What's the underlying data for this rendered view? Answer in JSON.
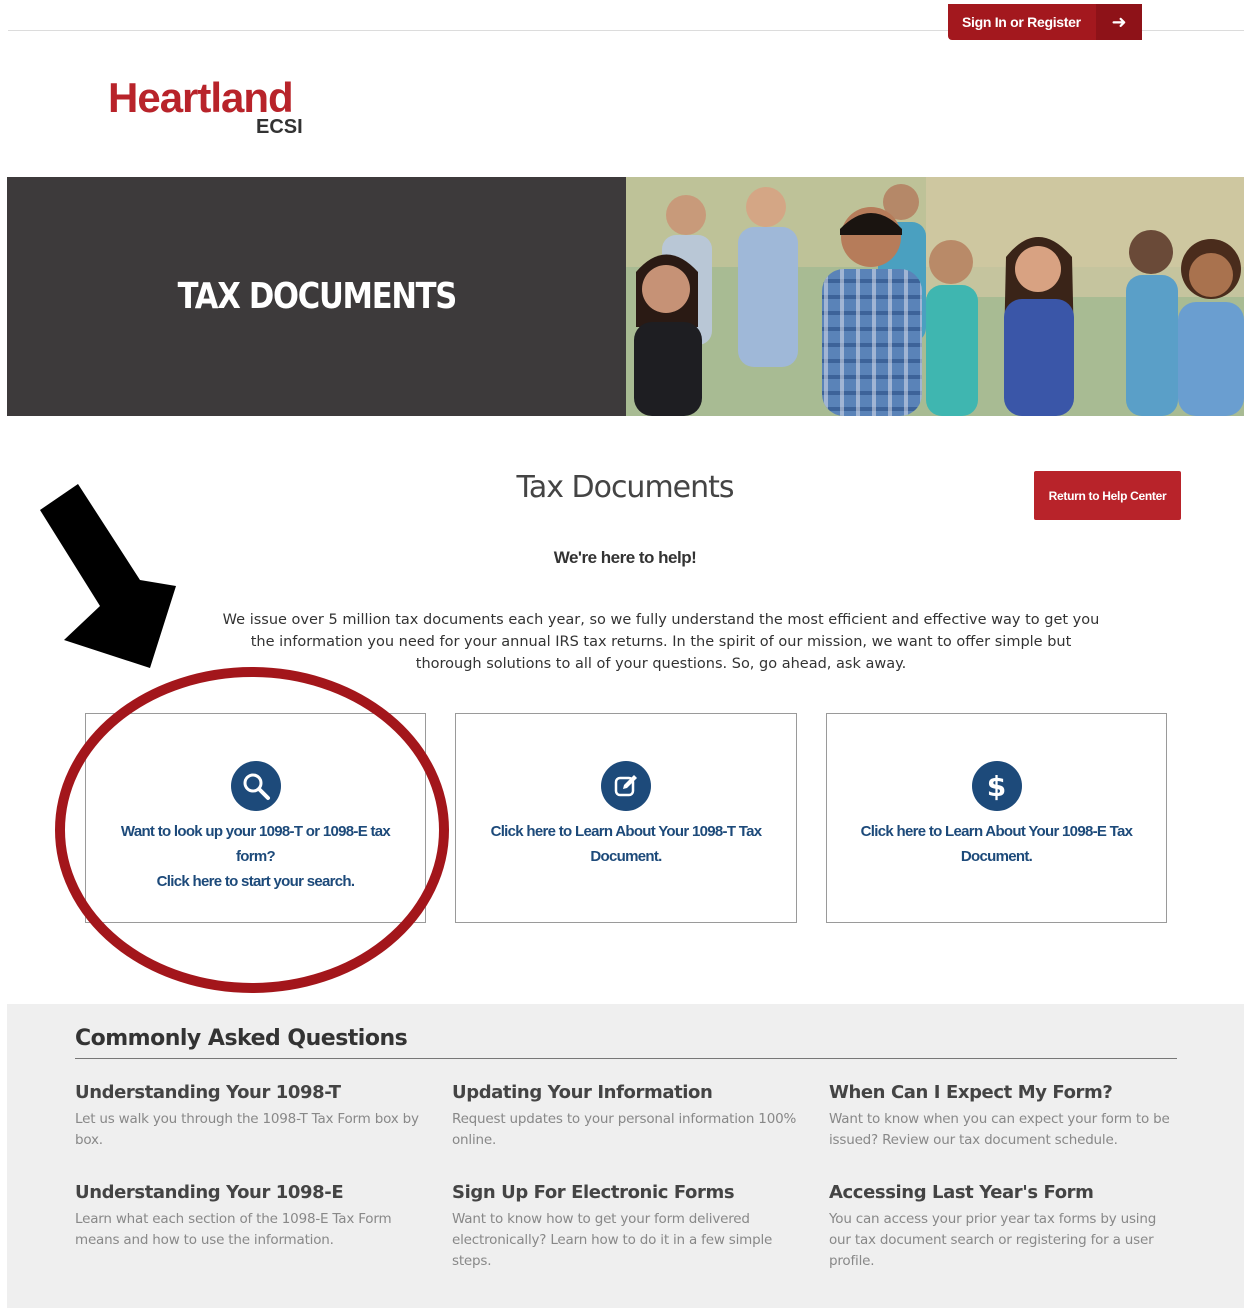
{
  "header": {
    "signin_label": "Sign In or Register",
    "signin_arrow": "➜"
  },
  "logo": {
    "brand": "Heartland",
    "sub": "ECSI"
  },
  "hero": {
    "title": "TAX DOCUMENTS"
  },
  "main": {
    "title": "Tax Documents",
    "help_button": "Return to Help Center",
    "tagline": "We're here to help!",
    "intro": "We issue over 5 million tax documents each year, so we fully understand the most efficient and effective way to get you the information you need for your annual IRS tax returns. In the spirit of our mission, we want to offer simple but thorough solutions to all of your questions. So, go ahead, ask away."
  },
  "cards": [
    {
      "icon": "search-icon",
      "line1": "Want to look up your 1098-T or 1098-E tax form?",
      "line2": "Click here to start your search."
    },
    {
      "icon": "edit-icon",
      "line1": "Click here to Learn About Your 1098-T Tax Document."
    },
    {
      "icon": "dollar-icon",
      "line1": "Click here to Learn About Your 1098-E Tax Document."
    }
  ],
  "faq": {
    "heading": "Commonly Asked Questions",
    "items": [
      {
        "title": "Understanding Your 1098-T",
        "body": "Let us walk you through the 1098-T Tax Form box by box."
      },
      {
        "title": "Updating Your Information",
        "body": "Request updates to your personal information 100% online."
      },
      {
        "title": "When Can I Expect My Form?",
        "body": "Want to know when you can expect your form to be issued? Review our tax document schedule."
      },
      {
        "title": "Understanding Your 1098-E",
        "body": "Learn what each section of the 1098-E Tax Form means and how to use the information."
      },
      {
        "title": "Sign Up For Electronic Forms",
        "body": "Want to know how to get your form delivered electronically? Learn how to do it in a few simple steps."
      },
      {
        "title": "Accessing Last Year's Form",
        "body": "You can access your prior year tax forms by using our tax document search or registering for a user profile."
      }
    ]
  },
  "colors": {
    "brand_red": "#b8232a",
    "link_blue": "#1d4a7a",
    "hero_dark": "#3d3a3b",
    "annotation_red": "#a3161b"
  }
}
